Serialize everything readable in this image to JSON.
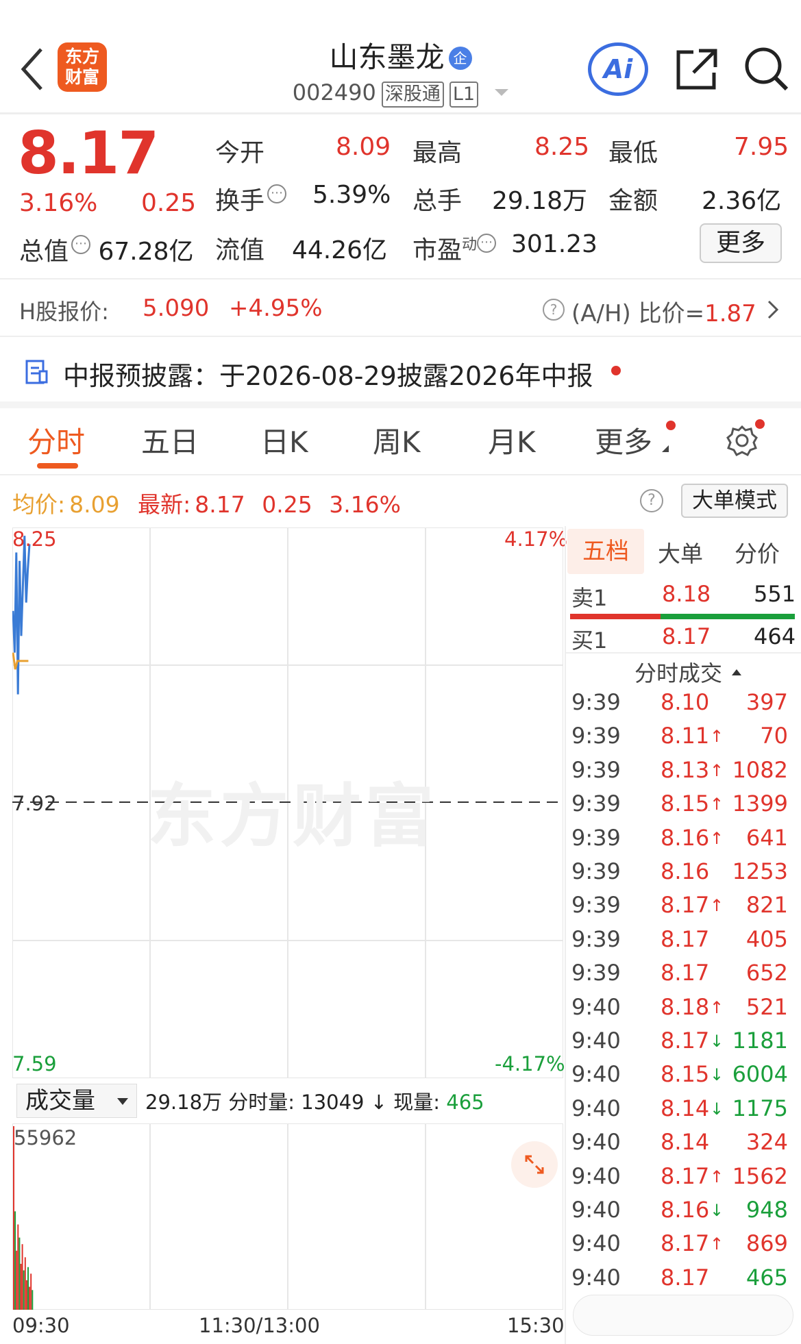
{
  "header": {
    "logo": "东方\n财富",
    "stock_name": "山东墨龙",
    "stock_badge": "企",
    "code": "002490",
    "tags": [
      "深股通",
      "L1"
    ],
    "ai_label": "Ai"
  },
  "quote": {
    "price": "8.17",
    "change_pct": "3.16%",
    "change": "0.25",
    "open_label": "今开",
    "open": "8.09",
    "high_label": "最高",
    "high": "8.25",
    "low_label": "最低",
    "low": "7.95",
    "turnover_label": "换手",
    "turnover": "5.39%",
    "volume_label": "总手",
    "volume": "29.18万",
    "amount_label": "金额",
    "amount": "2.36亿",
    "mktcap_label": "总值",
    "mktcap": "67.28亿",
    "float_label": "流值",
    "float_cap": "44.26亿",
    "pe_label": "市盈",
    "pe_sup": "动",
    "pe": "301.23",
    "more": "更多"
  },
  "hshare": {
    "label": "H股报价:",
    "price": "5.090",
    "change": "+4.95%",
    "ah_label": "(A/H) 比价=",
    "ah_value": "1.87"
  },
  "notice": {
    "text": "中报预披露：于2026-08-29披露2026年中报"
  },
  "tabs": [
    "分时",
    "五日",
    "日K",
    "周K",
    "月K",
    "更多"
  ],
  "info": {
    "avg_label": "均价:",
    "avg": "8.09",
    "latest_label": "最新:",
    "latest": "8.17",
    "chg": "0.25",
    "pct": "3.16%",
    "big_order": "大单模式"
  },
  "chart_data": {
    "type": "line",
    "y_max": "8.25",
    "y_mid": "7.92",
    "y_min": "7.59",
    "pct_max": "4.17%",
    "pct_min": "-4.17%",
    "x_labels": [
      "09:30",
      "11:30/13:00",
      "15:30"
    ],
    "price_series": [
      8.15,
      8.1,
      8.22,
      8.05,
      8.21,
      8.12,
      8.18,
      8.24,
      8.16,
      8.2,
      8.23
    ],
    "avg_series": [
      8.1,
      8.08,
      8.09,
      8.09,
      8.09,
      8.09,
      8.09,
      8.09
    ],
    "volume_max": "55962",
    "volumes": [
      55962,
      30000,
      18000,
      26000,
      22000,
      14000,
      20000,
      12000,
      16000,
      9000,
      13000,
      7000,
      11000,
      6000
    ]
  },
  "volbar": {
    "selector": "成交量",
    "total": "29.18万",
    "fs_label": "分时量:",
    "fs_value": "13049",
    "now_label": "现量:",
    "now_value": "465"
  },
  "orderbook": {
    "tabs": [
      "五档",
      "大单",
      "分价"
    ],
    "sell": {
      "label": "卖1",
      "price": "8.18",
      "qty": "551"
    },
    "buy": {
      "label": "买1",
      "price": "8.17",
      "qty": "464"
    },
    "ticks_title": "分时成交"
  },
  "ticks": [
    {
      "t": "9:39",
      "p": "8.10",
      "a": "",
      "v": "397",
      "c": "red"
    },
    {
      "t": "9:39",
      "p": "8.11",
      "a": "↑",
      "v": "70",
      "c": "red"
    },
    {
      "t": "9:39",
      "p": "8.13",
      "a": "↑",
      "v": "1082",
      "c": "red"
    },
    {
      "t": "9:39",
      "p": "8.15",
      "a": "↑",
      "v": "1399",
      "c": "red"
    },
    {
      "t": "9:39",
      "p": "8.16",
      "a": "↑",
      "v": "641",
      "c": "red"
    },
    {
      "t": "9:39",
      "p": "8.16",
      "a": "",
      "v": "1253",
      "c": "red"
    },
    {
      "t": "9:39",
      "p": "8.17",
      "a": "↑",
      "v": "821",
      "c": "red"
    },
    {
      "t": "9:39",
      "p": "8.17",
      "a": "",
      "v": "405",
      "c": "red"
    },
    {
      "t": "9:39",
      "p": "8.17",
      "a": "",
      "v": "652",
      "c": "red"
    },
    {
      "t": "9:40",
      "p": "8.18",
      "a": "↑",
      "v": "521",
      "c": "red"
    },
    {
      "t": "9:40",
      "p": "8.17",
      "a": "↓",
      "v": "1181",
      "c": "green"
    },
    {
      "t": "9:40",
      "p": "8.15",
      "a": "↓",
      "v": "6004",
      "c": "green"
    },
    {
      "t": "9:40",
      "p": "8.14",
      "a": "↓",
      "v": "1175",
      "c": "green"
    },
    {
      "t": "9:40",
      "p": "8.14",
      "a": "",
      "v": "324",
      "c": "red"
    },
    {
      "t": "9:40",
      "p": "8.17",
      "a": "↑",
      "v": "1562",
      "c": "red"
    },
    {
      "t": "9:40",
      "p": "8.16",
      "a": "↓",
      "v": "948",
      "c": "green"
    },
    {
      "t": "9:40",
      "p": "8.17",
      "a": "↑",
      "v": "869",
      "c": "red"
    },
    {
      "t": "9:40",
      "p": "8.17",
      "a": "",
      "v": "465",
      "c": "green"
    }
  ],
  "colors": {
    "up": "#e0342c",
    "down": "#1a9f3b",
    "accent": "#ee5a20",
    "price_line": "#3a7bd5",
    "avg_line": "#e8a031"
  }
}
